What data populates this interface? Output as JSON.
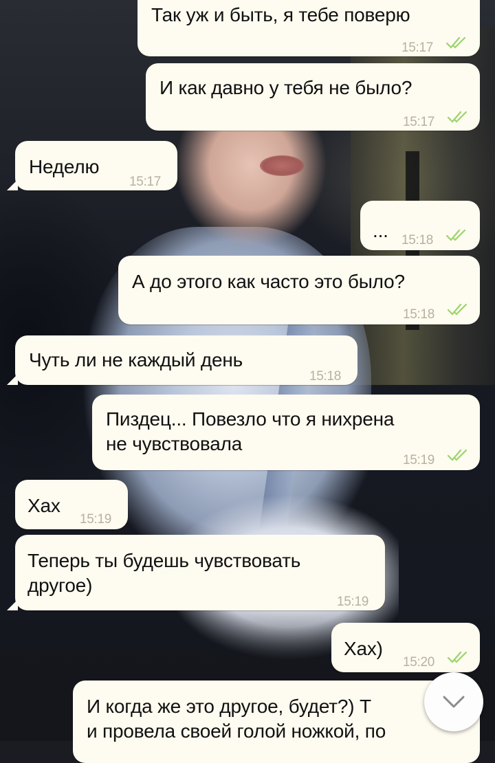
{
  "messages": [
    {
      "dir": "out",
      "text": "Так уж и быть, я тебе поверю",
      "time": "15:17"
    },
    {
      "dir": "out",
      "text": "И как давно у тебя не было?",
      "time": "15:17"
    },
    {
      "dir": "in",
      "text": "Неделю",
      "time": "15:17"
    },
    {
      "dir": "out",
      "text": "...",
      "time": "15:18"
    },
    {
      "dir": "out",
      "text": "А до этого как часто это было?",
      "time": "15:18"
    },
    {
      "dir": "in",
      "text": "Чуть ли не каждый день",
      "time": "15:18"
    },
    {
      "dir": "out",
      "text": "Пиздец... Повезло что я нихрена\nне чувствовала",
      "time": "15:19"
    },
    {
      "dir": "in",
      "text": "Хах",
      "time": "15:19"
    },
    {
      "dir": "in",
      "text": "Теперь ты будешь чувствовать\nдругое)",
      "time": "15:19"
    },
    {
      "dir": "out",
      "text": "Хах)",
      "time": "15:20"
    },
    {
      "dir": "out",
      "text": "И когда же это другое, будет?) Т\nи провела своей голой ножкой, по",
      "time": ""
    }
  ],
  "colors": {
    "bubble_bg": "#fefbf0",
    "time_text": "#b6b2a0",
    "read_ticks": "#9ad46b"
  },
  "icons": {
    "read_receipt": "double-check-icon",
    "scroll_down": "chevron-down-icon"
  }
}
